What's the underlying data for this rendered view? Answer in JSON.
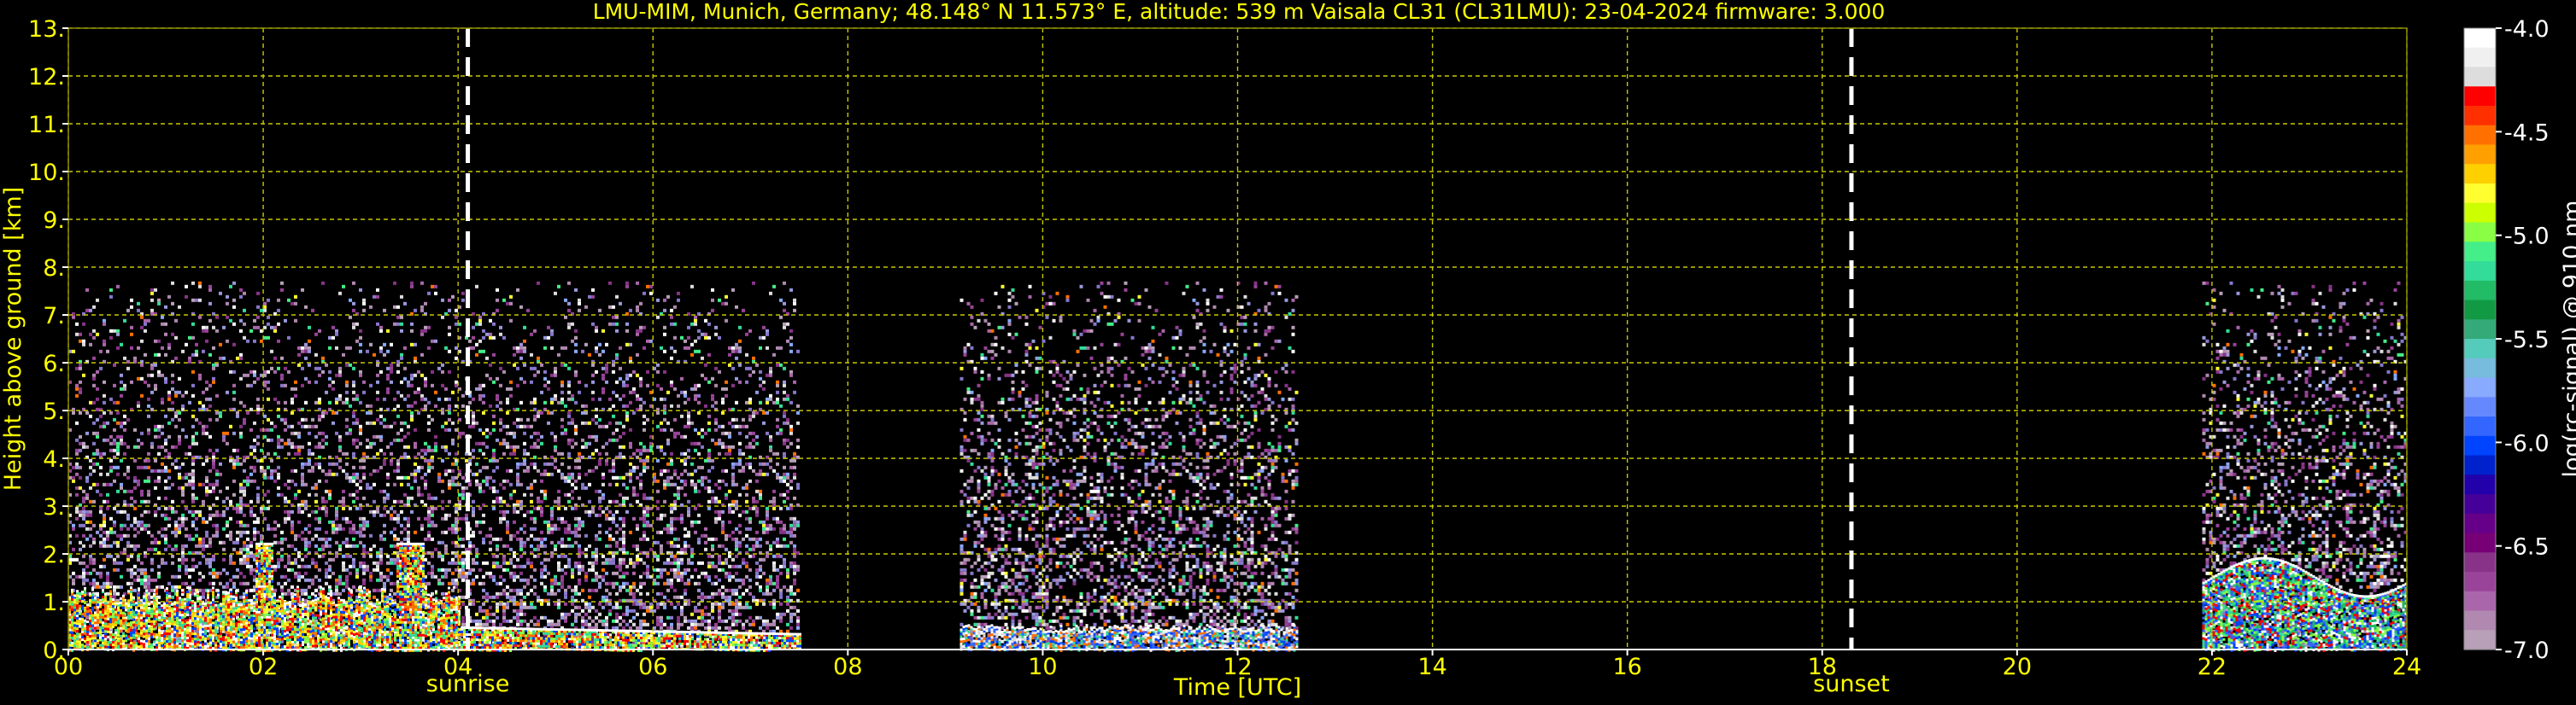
{
  "chart_data": {
    "type": "heatmap",
    "title": "LMU-MIM, Munich, Germany; 48.148° N 11.573° E, altitude: 539 m    Vaisala CL31 (CL31LMU): 23-04-2024    firmware: 3.000",
    "xlabel": "Time [UTC]",
    "ylabel": "Height above ground [km]",
    "xlim": [
      0,
      24
    ],
    "ylim": [
      0,
      13
    ],
    "x_ticks": [
      "00",
      "02",
      "04",
      "06",
      "08",
      "10",
      "12",
      "14",
      "16",
      "18",
      "20",
      "22",
      "24"
    ],
    "y_ticks": [
      "0.",
      "1.",
      "2.",
      "3.",
      "4.",
      "5.",
      "6.",
      "7.",
      "8.",
      "9.",
      "10.",
      "11.",
      "12.",
      "13."
    ],
    "grid": true,
    "colorbar": {
      "label": "log(rc-signal) @ 910 nm",
      "range": [
        -7.0,
        -4.0
      ],
      "ticks": [
        "-4.0",
        "-4.5",
        "-5.0",
        "-5.5",
        "-6.0",
        "-6.5",
        "-7.0"
      ],
      "colors": [
        "#ffffff",
        "#f0f0f0",
        "#dddddd",
        "#ff0000",
        "#ff3000",
        "#ff7000",
        "#ffa000",
        "#ffd000",
        "#ffff30",
        "#ccff00",
        "#88ff44",
        "#44ee88",
        "#33dd99",
        "#22bb66",
        "#119944",
        "#33aa77",
        "#55ccbb",
        "#77bbdd",
        "#88aaff",
        "#6688ff",
        "#3366ff",
        "#0044ff",
        "#0022cc",
        "#2200aa",
        "#440099",
        "#660088",
        "#770077",
        "#883388",
        "#994499",
        "#aa66aa",
        "#b088b0",
        "#b8a0b8"
      ]
    },
    "data_blocks": [
      {
        "start": 0.0,
        "end": 7.5,
        "top_km": 7.7
      },
      {
        "start": 9.15,
        "end": 12.6,
        "top_km": 7.7
      },
      {
        "start": 21.9,
        "end": 24.0,
        "top_km": 7.7
      }
    ],
    "annotations": [
      {
        "label": "sunrise",
        "time": 4.1
      },
      {
        "label": "sunset",
        "time": 18.3
      }
    ],
    "colors": {
      "text": "#ffff00",
      "grid": "#c8c800",
      "marker_line": "#ffffff",
      "background": "#000000"
    }
  }
}
